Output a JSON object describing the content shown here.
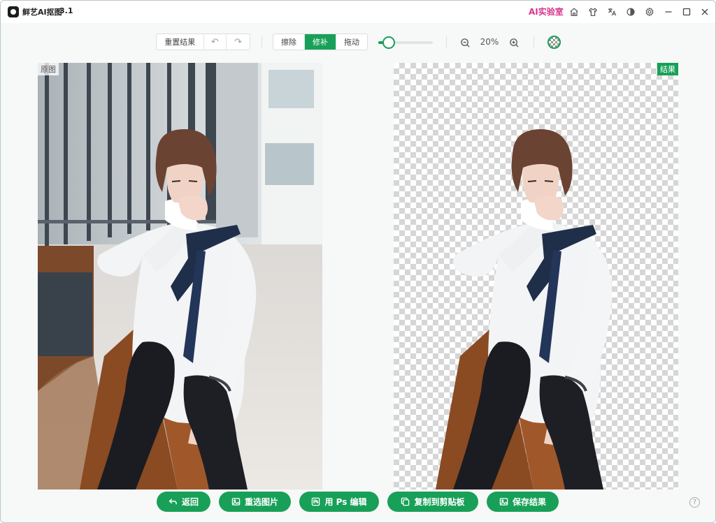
{
  "titlebar": {
    "app_name": "鲜艺AI抠图",
    "version": "3.1",
    "ai_lab": "AI实验室",
    "icons": [
      "home-icon",
      "skin-icon",
      "translate-icon",
      "theme-icon",
      "settings-icon"
    ],
    "window_controls": [
      "minimize",
      "maximize",
      "close"
    ]
  },
  "toolbar": {
    "reset_label": "重置结果",
    "undo_glyph": "↶",
    "redo_glyph": "↷",
    "modes": [
      {
        "label": "擦除",
        "active": false
      },
      {
        "label": "修补",
        "active": true
      },
      {
        "label": "拖动",
        "active": false
      }
    ],
    "brush_size_level": 0.18,
    "zoom_label": "20%"
  },
  "panels": {
    "original_label": "原图",
    "result_label": "结果"
  },
  "actions": [
    {
      "label": "返回",
      "icon": "back-icon"
    },
    {
      "label": "重选图片",
      "icon": "image-icon"
    },
    {
      "label": "用 Ps 编辑",
      "icon": "ps-icon"
    },
    {
      "label": "复制到剪贴板",
      "icon": "copy-icon"
    },
    {
      "label": "保存结果",
      "icon": "save-image-icon"
    }
  ],
  "help": "?",
  "colors": {
    "accent": "#18a058",
    "ai_lab": "#d8358a",
    "tie": "#1f2f4a",
    "stockings": "#1b1c21",
    "bench": "#8a4a22"
  }
}
